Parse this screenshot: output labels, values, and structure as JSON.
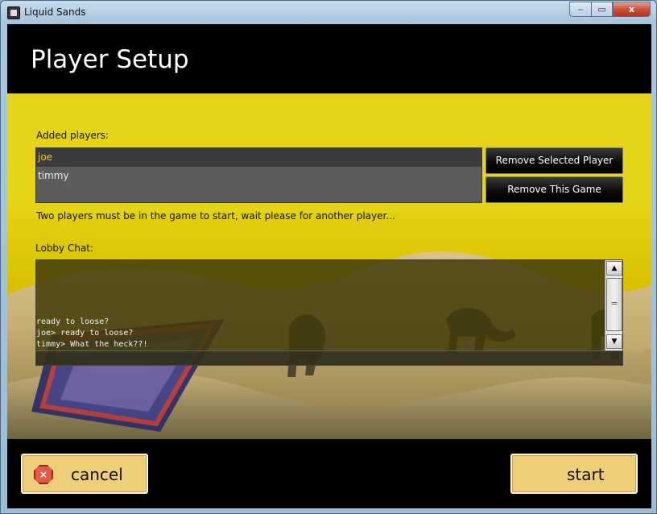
{
  "window": {
    "title": "Liquid Sands",
    "controls": {
      "minimize": "‒",
      "maximize": "▭",
      "close": "x"
    }
  },
  "header": {
    "title": "Player Setup"
  },
  "players": {
    "label": "Added players:",
    "items": [
      "joe",
      "timmy"
    ],
    "selected_index": 0,
    "remove_selected_label": "Remove Selected Player",
    "remove_game_label": "Remove This Game",
    "status_message": "Two players must be in the game to start, wait please for another player..."
  },
  "chat": {
    "label": "Lobby Chat:",
    "lines": [
      "ready to loose?",
      "joe> ready to loose?",
      "timmy> What the heck??!"
    ],
    "input_value": ""
  },
  "footer": {
    "cancel_label": "cancel",
    "start_label": "start"
  },
  "colors": {
    "sky_yellow": "#e4d51c",
    "selected_player": "#f2c326",
    "button_gold": "#efce7a",
    "cancel_icon": "#e25a4a"
  }
}
